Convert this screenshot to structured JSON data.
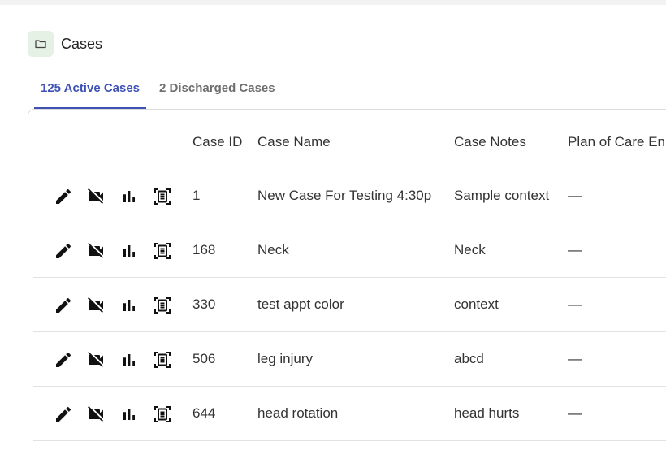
{
  "header": {
    "title": "Cases",
    "icon": "folder-icon"
  },
  "tabs": [
    {
      "label": "125 Active Cases",
      "active": true
    },
    {
      "label": "2 Discharged Cases",
      "active": false
    }
  ],
  "columns": {
    "case_id": "Case ID",
    "case_name": "Case Name",
    "case_notes": "Case Notes",
    "plan": "Plan of Care En"
  },
  "row_actions": [
    "edit-icon",
    "video-off-icon",
    "chart-icon",
    "document-scan-icon"
  ],
  "rows": [
    {
      "id": "1",
      "name": "New Case For Testing 4:30p",
      "notes": "Sample context",
      "plan": "—"
    },
    {
      "id": "168",
      "name": "Neck",
      "notes": "Neck",
      "plan": "—"
    },
    {
      "id": "330",
      "name": "test appt color",
      "notes": "context",
      "plan": "—"
    },
    {
      "id": "506",
      "name": "leg injury",
      "notes": "abcd",
      "plan": "—"
    },
    {
      "id": "644",
      "name": "head rotation",
      "notes": "head hurts",
      "plan": "—"
    }
  ],
  "colors": {
    "accent": "#3f51b5",
    "badge_bg": "#e4f1e4",
    "border": "#dcdcdc"
  }
}
